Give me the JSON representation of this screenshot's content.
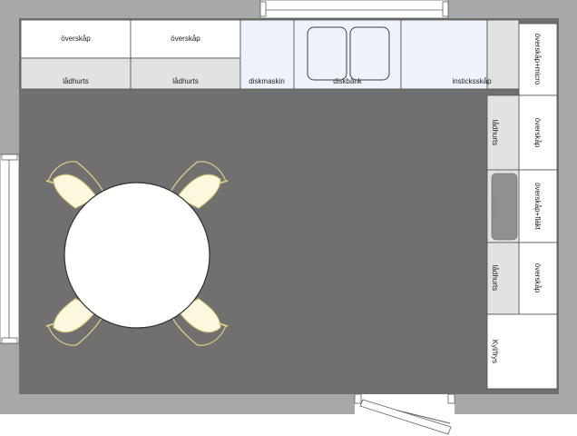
{
  "colors": {
    "wall": "#a8a8a8",
    "floor": "#707070",
    "cabinet": "#ffffff",
    "drawer_unit": "#e2e2e2",
    "appliance": "#eef3fb",
    "hob": "#909090",
    "table": "#ffffff",
    "chair": "#fbf8de",
    "chair_leg": "#d7c985"
  },
  "labels": {
    "overskap_top_1": "överskåp",
    "overskap_top_2": "överskåp",
    "ladhurts_top_1": "lådhurts",
    "ladhurts_top_2": "lådhurts",
    "diskmaskin": "diskmaskin",
    "diskbank": "diskbänk",
    "insticksskap": "insticksskåp",
    "overskap_micro": "överskåp+micro",
    "overskap_right": "överskåp",
    "overskap_flakt": "överskåp+fläkt",
    "overskap_right_2": "överskåp",
    "ladhurts_right_1": "lådhurts",
    "spishall": "spishäll",
    "ladhurts_right_2": "lådhurts",
    "kylfrys": "Kyl/frys"
  }
}
